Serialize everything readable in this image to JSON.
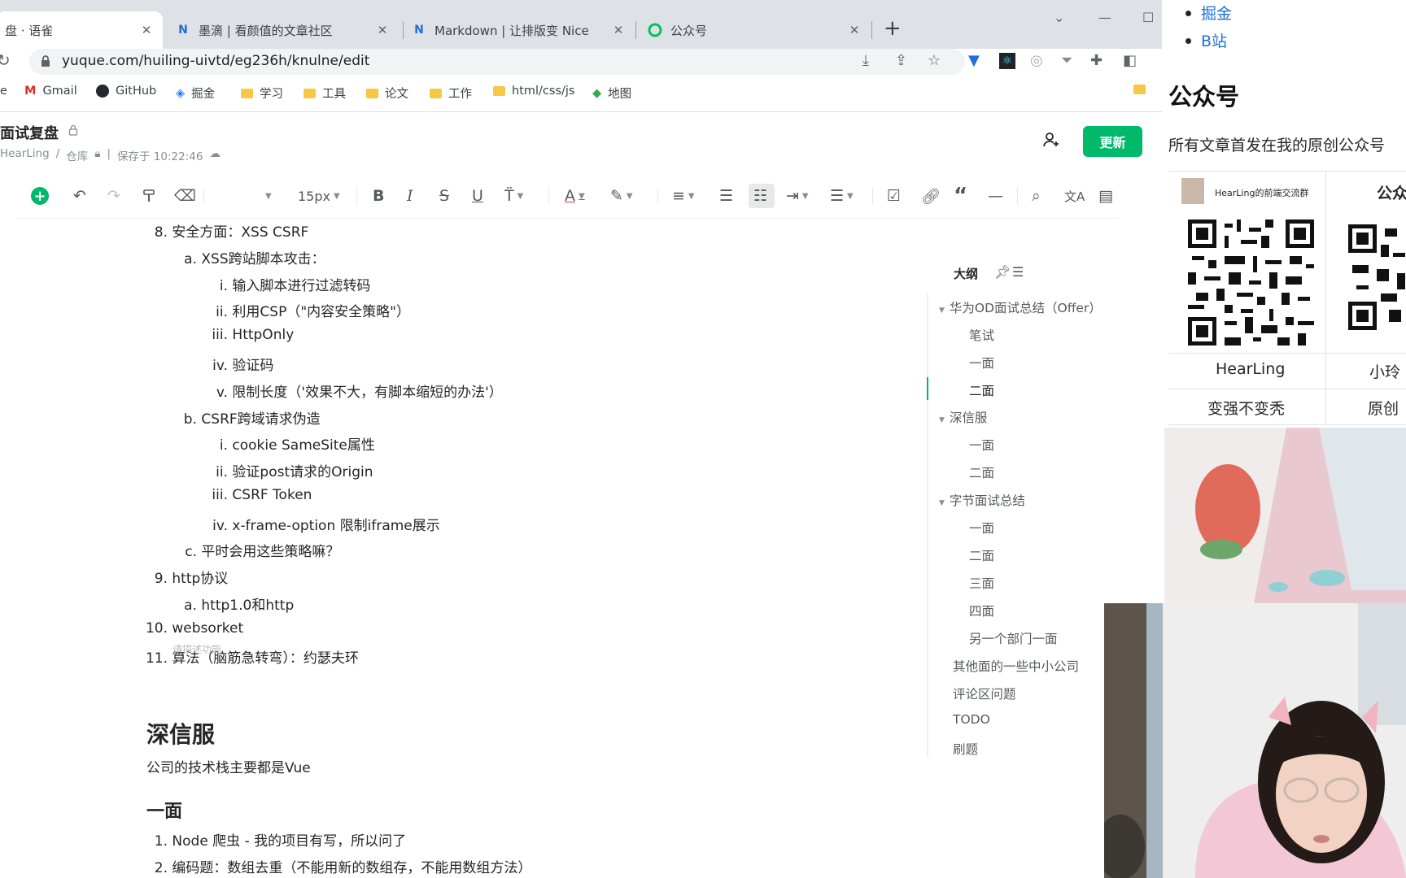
{
  "tabs": [
    {
      "title": "盘 · 语雀",
      "favicon": "yuque-icon",
      "active": true
    },
    {
      "title": "墨滴 | 看颜值的文章社区",
      "favicon": "mdnice-icon",
      "active": false
    },
    {
      "title": "Markdown | 让排版变 Nice",
      "favicon": "mdnice-icon",
      "active": false
    },
    {
      "title": "公众号",
      "favicon": "wechat-mp-icon",
      "active": false
    }
  ],
  "address_bar": {
    "url": "yuque.com/huiling-uivtd/eg236h/knulne/edit"
  },
  "bookmarks": [
    "e",
    "Gmail",
    "GitHub",
    "掘金",
    "学习",
    "工具",
    "论文",
    "工作",
    "html/css/js",
    "地图"
  ],
  "doc": {
    "title": "面试复盘",
    "meta": {
      "author": "HearLing",
      "repo": "仓库",
      "saved": "保存于 10:22:46"
    },
    "update_label": "更新"
  },
  "toolbar": {
    "font_size": "15px"
  },
  "content": [
    {
      "num": "8.",
      "text": "安全方面：XSS CSRF"
    },
    {
      "num": "a.",
      "text": "XSS跨站脚本攻击："
    },
    {
      "num": "i.",
      "text": "输入脚本进行过滤转码"
    },
    {
      "num": "ii.",
      "text": "利用CSP（\"内容安全策略\"）"
    },
    {
      "num": "iii.",
      "text": "HttpOnly"
    },
    {
      "num": "iv.",
      "text": "验证码"
    },
    {
      "num": "v.",
      "text": "限制长度（'效果不大，有脚本缩短的办法'）"
    },
    {
      "num": "b.",
      "text": "CSRF跨域请求伪造"
    },
    {
      "num": "i.",
      "text": "cookie SameSite属性"
    },
    {
      "num": "ii.",
      "text": "验证post请求的Origin"
    },
    {
      "num": "iii.",
      "text": "CSRF Token"
    },
    {
      "num": "iv.",
      "text": "x-frame-option 限制iframe展示"
    },
    {
      "num": "c.",
      "text": "平时会用这些策略嘛？"
    },
    {
      "num": "9.",
      "text": "http协议"
    },
    {
      "num": "a.",
      "text": "http1.0和http"
    },
    {
      "num": "10.",
      "text": "websorket"
    },
    {
      "num": "11.",
      "text": "算法（脑筋急转弯）：约瑟夫环"
    }
  ],
  "ghost_text": "请描述功能",
  "section_h2": "深信服",
  "section_p": "公司的技术栈主要都是Vue",
  "section_h3": "一面",
  "content2": [
    {
      "num": "1.",
      "text": "Node 爬虫 - 我的项目有写，所以问了"
    },
    {
      "num": "2.",
      "text": "编码题：数组去重（不能用新的数组存，不能用数组方法）"
    }
  ],
  "outline": {
    "title": "大纲",
    "items": [
      {
        "text": "华为OD面试总结（Offer）",
        "level": 1,
        "collapsible": true
      },
      {
        "text": "笔试",
        "level": 2
      },
      {
        "text": "一面",
        "level": 2
      },
      {
        "text": "二面",
        "level": 2,
        "active": true
      },
      {
        "text": "深信服",
        "level": 1,
        "collapsible": true
      },
      {
        "text": "一面",
        "level": 2
      },
      {
        "text": "二面",
        "level": 2
      },
      {
        "text": "字节面试总结",
        "level": 1,
        "collapsible": true
      },
      {
        "text": "一面",
        "level": 2
      },
      {
        "text": "二面",
        "level": 2
      },
      {
        "text": "三面",
        "level": 2
      },
      {
        "text": "四面",
        "level": 2
      },
      {
        "text": "另一个部门一面",
        "level": 2
      },
      {
        "text": "其他面的一些中小公司",
        "level": 1
      },
      {
        "text": "评论区问题",
        "level": 1
      },
      {
        "text": "TODO",
        "level": 1
      },
      {
        "text": "刷题",
        "level": 1
      }
    ]
  },
  "right_page": {
    "links": [
      "掘金",
      "B站"
    ],
    "heading": "公众号",
    "desc": "所有文章首发在我的原创公众号",
    "group_label": "HearLing的前端交流群",
    "col2_header": "公众",
    "row1": [
      "HearLing",
      "小玲"
    ],
    "row2": [
      "变强不变秃",
      "原创"
    ]
  },
  "colors": {
    "accent": "#00b96b",
    "link": "#1e6fd9",
    "tabstrip": "#dee1e6"
  }
}
